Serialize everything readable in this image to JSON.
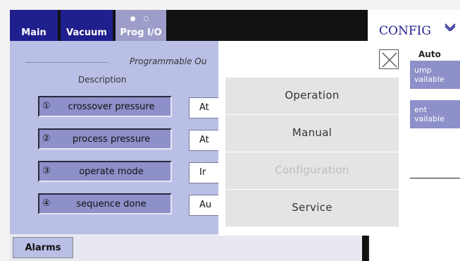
{
  "tabs": [
    {
      "label": "Main"
    },
    {
      "label": "Vacuum"
    },
    {
      "label": "Prog I/O",
      "dots": "● ○"
    }
  ],
  "panel": {
    "title": "Programmable Ou",
    "description_header": "Description",
    "rows": [
      {
        "number": "①",
        "description": "crossover pressure",
        "value": "At"
      },
      {
        "number": "②",
        "description": "process pressure",
        "value": "At"
      },
      {
        "number": "③",
        "description": "operate mode",
        "value": "Ir"
      },
      {
        "number": "④",
        "description": "sequence done",
        "value": "Au"
      }
    ]
  },
  "bottom": {
    "alarms_label": "Alarms"
  },
  "right_panel": {
    "config_label": "CONFIG",
    "chevron_icon": "chevron-down-icon",
    "mode_label": "Auto",
    "box1": [
      "ump",
      "vailable"
    ],
    "box2": [
      "ent",
      "vailable"
    ]
  },
  "menu": {
    "close_icon": "close-icon",
    "items": [
      {
        "label": "Operation",
        "enabled": true
      },
      {
        "label": "Manual",
        "enabled": true
      },
      {
        "label": "Configuration",
        "enabled": false
      },
      {
        "label": "Service",
        "enabled": true
      }
    ]
  },
  "colors": {
    "tab_blue": "#1f1f8e",
    "panel_bg": "#b9bfe5",
    "button_bg": "#8d90c9"
  }
}
